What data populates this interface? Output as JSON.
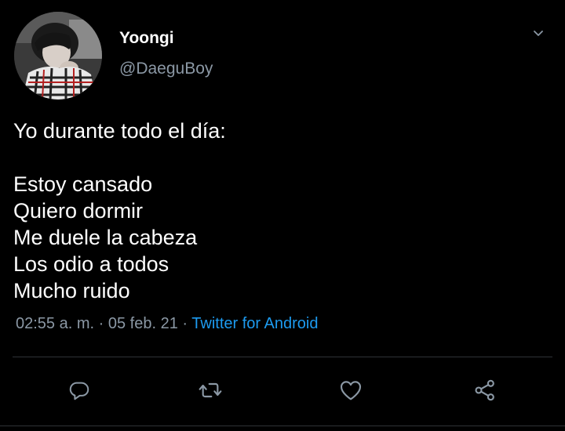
{
  "user": {
    "display_name": "Yoongi",
    "handle": "@DaeguBoy"
  },
  "tweet": {
    "lines": [
      "Yo durante todo el día:",
      "",
      "Estoy cansado",
      "Quiero dormir",
      "Me duele la cabeza",
      "Los odio a todos",
      "Mucho ruido"
    ]
  },
  "meta": {
    "time": "02:55 a. m.",
    "separator": "·",
    "date": "05 feb. 21",
    "source": "Twitter for Android"
  },
  "icons": {
    "menu": "chevron-down-icon",
    "reply": "reply-icon",
    "retweet": "retweet-icon",
    "like": "heart-icon",
    "share": "share-icon"
  },
  "colors": {
    "background": "#000000",
    "text": "#ffffff",
    "secondary": "#8b98a5",
    "link": "#1d9bf0",
    "divider": "#2f3336"
  }
}
